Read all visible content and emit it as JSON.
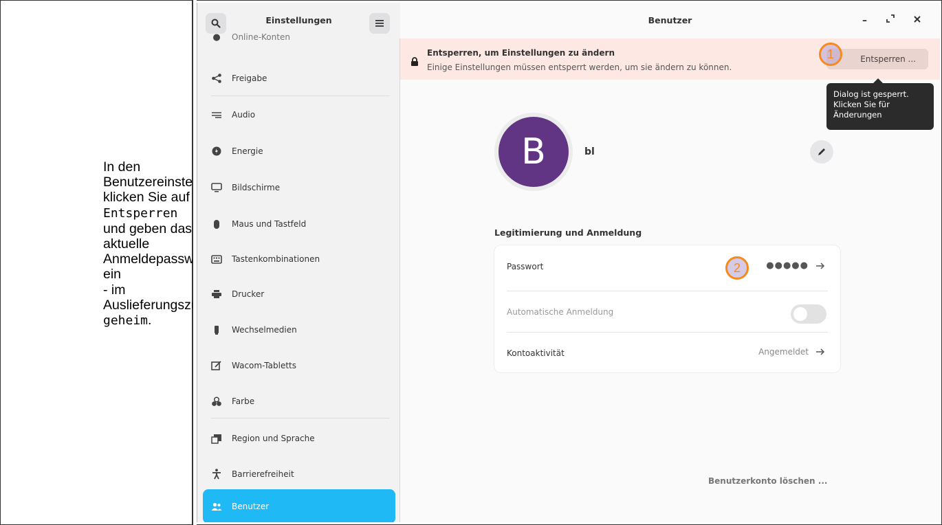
{
  "instruction": {
    "line1": "In den",
    "line2": "Benutzereinstellungen",
    "line3": "klicken Sie auf",
    "code1": "Entsperren",
    "line4": "und geben das",
    "line5": "aktuelle",
    "line6": "Anmeldepasswort ein",
    "line7": "- im",
    "line8": "Auslieferungszustand",
    "code2": "geheim",
    "line9": "."
  },
  "sidebar": {
    "title": "Einstellungen",
    "items": [
      {
        "label": "Online-Konten",
        "icon": "online-accounts-icon"
      },
      {
        "label": "Freigabe",
        "icon": "share-icon"
      },
      {
        "label": "Audio",
        "icon": "audio-icon"
      },
      {
        "label": "Energie",
        "icon": "power-icon"
      },
      {
        "label": "Bildschirme",
        "icon": "display-icon"
      },
      {
        "label": "Maus und Tastfeld",
        "icon": "mouse-icon"
      },
      {
        "label": "Tastenkombinationen",
        "icon": "keyboard-icon"
      },
      {
        "label": "Drucker",
        "icon": "printer-icon"
      },
      {
        "label": "Wechselmedien",
        "icon": "removable-media-icon"
      },
      {
        "label": "Wacom-Tabletts",
        "icon": "tablet-icon"
      },
      {
        "label": "Farbe",
        "icon": "color-icon"
      },
      {
        "label": "Region und Sprache",
        "icon": "region-icon"
      },
      {
        "label": "Barrierefreiheit",
        "icon": "accessibility-icon"
      },
      {
        "label": "Benutzer",
        "icon": "users-icon",
        "active": true
      }
    ]
  },
  "main": {
    "title": "Benutzer",
    "banner": {
      "title": "Entsperren, um Einstellungen zu ändern",
      "subtitle": "Einige Einstellungen müssen entsperrt werden, um sie ändern zu können.",
      "button": "Entsperren ..."
    },
    "tooltip": {
      "line1": "Dialog ist gesperrt.",
      "line2": "Klicken Sie für",
      "line3": "Änderungen"
    },
    "markers": [
      "1",
      "2"
    ],
    "avatar_letter": "B",
    "avatar_color": "#613583",
    "username": "bl",
    "section_title": "Legitimierung und Anmeldung",
    "rows": {
      "password_label": "Passwort",
      "password_value": "●●●●●",
      "autologin_label": "Automatische Anmeldung",
      "autologin_on": false,
      "activity_label": "Kontoaktivität",
      "activity_value": "Angemeldet"
    },
    "delete_label": "Benutzerkonto löschen ..."
  },
  "colors": {
    "accent": "#1fb9f6",
    "banner_bg": "#fde8e4",
    "marker": "#f58a1f"
  }
}
